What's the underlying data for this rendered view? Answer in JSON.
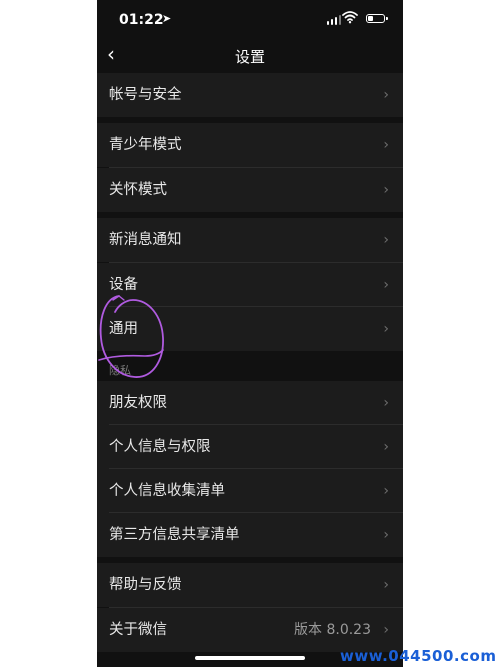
{
  "status_bar": {
    "time": "01:22",
    "location_icon": "➤"
  },
  "nav": {
    "back_icon": "‹",
    "title": "设置"
  },
  "groups": [
    {
      "items": [
        {
          "label": "帐号与安全",
          "chevron": "›"
        }
      ]
    },
    {
      "items": [
        {
          "label": "青少年模式",
          "chevron": "›"
        },
        {
          "label": "关怀模式",
          "chevron": "›"
        }
      ]
    },
    {
      "items": [
        {
          "label": "新消息通知",
          "chevron": "›"
        },
        {
          "label": "设备",
          "chevron": "›"
        },
        {
          "label": "通用",
          "chevron": "›"
        }
      ]
    },
    {
      "header": "隐私",
      "items": [
        {
          "label": "朋友权限",
          "chevron": "›"
        },
        {
          "label": "个人信息与权限",
          "chevron": "›"
        },
        {
          "label": "个人信息收集清单",
          "chevron": "›"
        },
        {
          "label": "第三方信息共享清单",
          "chevron": "›"
        }
      ]
    },
    {
      "items": [
        {
          "label": "帮助与反馈",
          "chevron": "›"
        },
        {
          "label": "关于微信",
          "value": "版本 8.0.23",
          "chevron": "›"
        }
      ]
    }
  ],
  "watermark": "www.044500.com",
  "colors": {
    "background": "#111111",
    "row": "#1c1c1c",
    "text": "#e8e8e8",
    "annotation": "#b05be0",
    "watermark": "#1a5fd6"
  }
}
